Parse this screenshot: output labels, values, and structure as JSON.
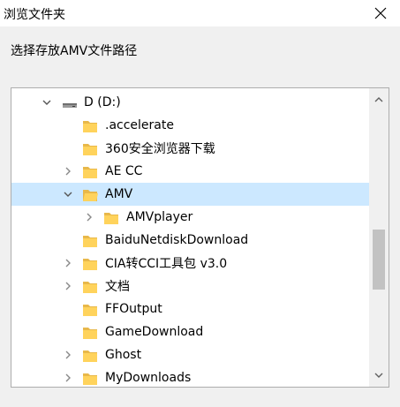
{
  "window": {
    "title": "浏览文件夹"
  },
  "prompt": "选择存放AMV文件路径",
  "tree": {
    "rows": [
      {
        "label": "D (D:)",
        "chevron": "chevron-down-icon",
        "icon": "drive-icon"
      },
      {
        "label": ".accelerate",
        "chevron": "",
        "icon": "folder-icon"
      },
      {
        "label": "360安全浏览器下载",
        "chevron": "",
        "icon": "folder-icon"
      },
      {
        "label": "AE CC",
        "chevron": "chevron-right-icon",
        "icon": "folder-icon"
      },
      {
        "label": "AMV",
        "chevron": "chevron-down-icon",
        "icon": "folder-open-icon",
        "selected": true
      },
      {
        "label": "AMVplayer",
        "chevron": "chevron-right-icon",
        "icon": "folder-icon"
      },
      {
        "label": "BaiduNetdiskDownload",
        "chevron": "",
        "icon": "folder-icon"
      },
      {
        "label": "CIA转CCI工具包 v3.0",
        "chevron": "chevron-right-icon",
        "icon": "folder-icon"
      },
      {
        "label": "文档",
        "chevron": "chevron-right-icon",
        "icon": "folder-icon"
      },
      {
        "label": "FFOutput",
        "chevron": "",
        "icon": "folder-icon"
      },
      {
        "label": "GameDownload",
        "chevron": "",
        "icon": "folder-icon"
      },
      {
        "label": "Ghost",
        "chevron": "chevron-right-icon",
        "icon": "folder-icon"
      },
      {
        "label": "MyDownloads",
        "chevron": "chevron-right-icon",
        "icon": "folder-icon"
      }
    ]
  },
  "colors": {
    "selection": "#cce8ff",
    "folder": "#ffd35c",
    "scrollbar_thumb": "#c2c2c2"
  }
}
